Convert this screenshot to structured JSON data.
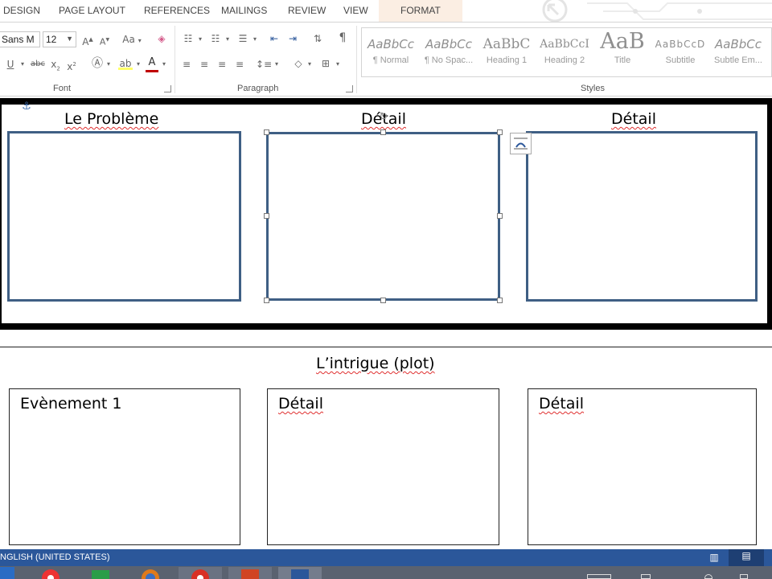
{
  "ribbon": {
    "tabs": [
      {
        "label": "DESIGN"
      },
      {
        "label": "PAGE LAYOUT"
      },
      {
        "label": "REFERENCES"
      },
      {
        "label": "MAILINGS"
      },
      {
        "label": "REVIEW"
      },
      {
        "label": "VIEW"
      },
      {
        "label": "FORMAT"
      }
    ],
    "font": {
      "family_value": "Sans M",
      "size_value": "12",
      "group_label": "Font"
    },
    "paragraph": {
      "group_label": "Paragraph"
    },
    "styles": {
      "group_label": "Styles",
      "items": [
        {
          "sample": "AaBbCc",
          "name": "¶ Normal"
        },
        {
          "sample": "AaBbCc",
          "name": "¶ No Spac..."
        },
        {
          "sample": "AaBbC",
          "name": "Heading 1"
        },
        {
          "sample": "AaBbCcI",
          "name": "Heading 2"
        },
        {
          "sample": "AaB",
          "name": "Title"
        },
        {
          "sample": "AaBbCcD",
          "name": "Subtitle"
        },
        {
          "sample": "AaBbCc",
          "name": "Subtle Em..."
        }
      ]
    },
    "font_color": "#c00000"
  },
  "document": {
    "top_section": {
      "headings": [
        "Le Problème",
        "Détail",
        "Détail"
      ]
    },
    "bottom_section": {
      "title": "L’intrigue (plot)",
      "boxes": [
        {
          "label": "Evènement 1"
        },
        {
          "label": "Détail"
        },
        {
          "label": "Détail"
        }
      ]
    },
    "accent_color": "#3f5f84"
  },
  "status_bar": {
    "language": "NGLISH (UNITED STATES)",
    "color": "#2b579a"
  }
}
